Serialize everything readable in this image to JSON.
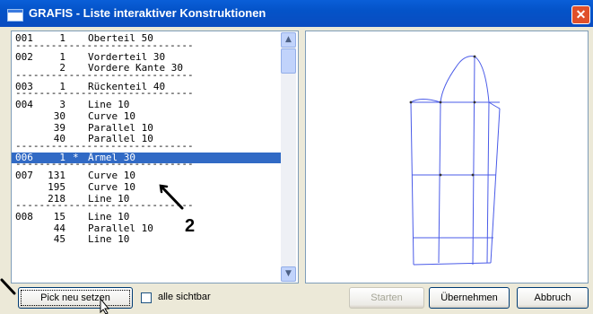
{
  "window": {
    "title": "GRAFIS - Liste interaktiver Konstruktionen",
    "close_glyph": "✕"
  },
  "list": [
    {
      "type": "row",
      "id": "001",
      "num": "1",
      "star": "",
      "name": "Oberteil 50"
    },
    {
      "type": "sep"
    },
    {
      "type": "row",
      "id": "002",
      "num": "1",
      "star": "",
      "name": "Vorderteil 30"
    },
    {
      "type": "row",
      "id": "",
      "num": "2",
      "star": "",
      "name": "Vordere Kante 30"
    },
    {
      "type": "sep"
    },
    {
      "type": "row",
      "id": "003",
      "num": "1",
      "star": "",
      "name": "Rückenteil 40"
    },
    {
      "type": "sep"
    },
    {
      "type": "row",
      "id": "004",
      "num": "3",
      "star": "",
      "name": "Line 10"
    },
    {
      "type": "row",
      "id": "",
      "num": "30",
      "star": "",
      "name": "Curve 10"
    },
    {
      "type": "row",
      "id": "",
      "num": "39",
      "star": "",
      "name": "Parallel 10"
    },
    {
      "type": "row",
      "id": "",
      "num": "40",
      "star": "",
      "name": "Parallel 10"
    },
    {
      "type": "sep"
    },
    {
      "type": "row",
      "id": "006",
      "num": "1",
      "star": "*",
      "name": "Ärmel 30",
      "selected": true
    },
    {
      "type": "sep"
    },
    {
      "type": "row",
      "id": "007",
      "num": "131",
      "star": "",
      "name": "Curve 10"
    },
    {
      "type": "row",
      "id": "",
      "num": "195",
      "star": "",
      "name": "Curve 10"
    },
    {
      "type": "row",
      "id": "",
      "num": "218",
      "star": "",
      "name": "Line 10"
    },
    {
      "type": "sep"
    },
    {
      "type": "row",
      "id": "008",
      "num": "15",
      "star": "",
      "name": "Line 10"
    },
    {
      "type": "row",
      "id": "",
      "num": "44",
      "star": "",
      "name": "Parallel 10"
    },
    {
      "type": "row",
      "id": "",
      "num": "45",
      "star": "",
      "name": "Line 10"
    }
  ],
  "separator_text": "------------------------------",
  "buttons": {
    "pick": "Pick neu setzen",
    "starten": "Starten",
    "uebernehmen": "Übernehmen",
    "abbruch": "Abbruch"
  },
  "checkbox": {
    "label": "alle sichtbar",
    "checked": false
  },
  "annotation": {
    "label": "2"
  },
  "colors": {
    "selection": "#316ac5",
    "sketch_line": "#4a5be8",
    "titlebar": "#0453c8"
  }
}
